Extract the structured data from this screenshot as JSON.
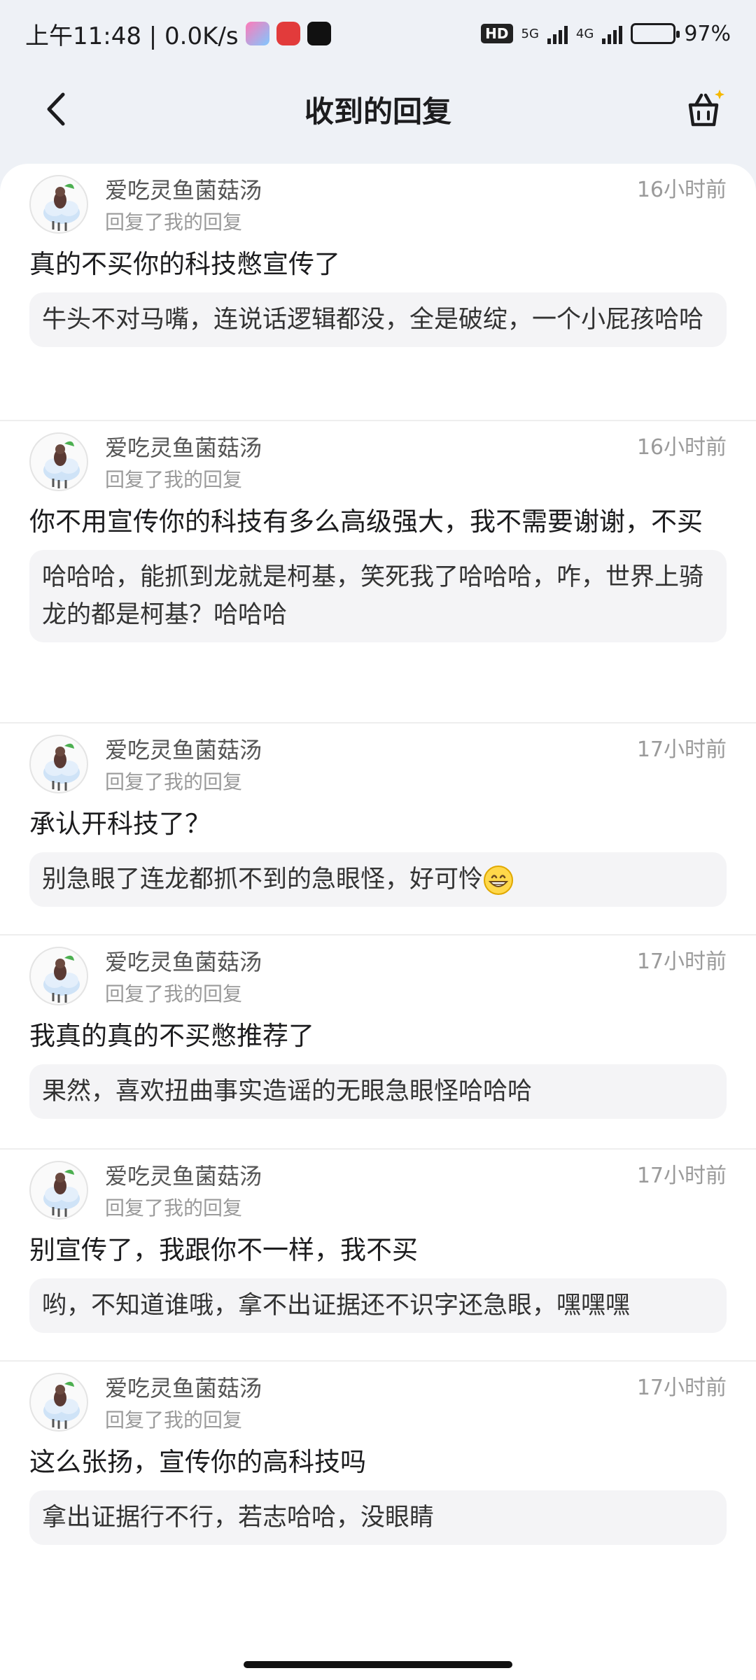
{
  "status": {
    "time_speed": "上午11:48 | 0.0K/s",
    "hd": "HD",
    "sig1": "5G",
    "sig2": "4G",
    "battery": "97%",
    "battery_level": 0.97
  },
  "nav": {
    "title": "收到的回复"
  },
  "replies": [
    {
      "user": "爱吃灵鱼菌菇汤",
      "action": "回复了我的回复",
      "time": "16小时前",
      "text": "真的不买你的科技憋宣传了",
      "quote": "牛头不对马嘴，连说话逻辑都没，全是破绽，一个小屁孩哈哈"
    },
    {
      "user": "爱吃灵鱼菌菇汤",
      "action": "回复了我的回复",
      "time": "16小时前",
      "text": "你不用宣传你的科技有多么高级强大，我不需要谢谢，不买",
      "quote": "哈哈哈，能抓到龙就是柯基，笑死我了哈哈哈，咋，世界上骑龙的都是柯基？哈哈哈"
    },
    {
      "user": "爱吃灵鱼菌菇汤",
      "action": "回复了我的回复",
      "time": "17小时前",
      "text": "承认开科技了？",
      "quote": "别急眼了连龙都抓不到的急眼怪，好可怜"
    },
    {
      "user": "爱吃灵鱼菌菇汤",
      "action": "回复了我的回复",
      "time": "17小时前",
      "text": "我真的真的不买憋推荐了",
      "quote": "果然，喜欢扭曲事实造谣的无眼急眼怪哈哈哈"
    },
    {
      "user": "爱吃灵鱼菌菇汤",
      "action": "回复了我的回复",
      "time": "17小时前",
      "text": "别宣传了，我跟你不一样，我不买",
      "quote": "哟，不知道谁哦，拿不出证据还不识字还急眼，嘿嘿嘿"
    },
    {
      "user": "爱吃灵鱼菌菇汤",
      "action": "回复了我的回复",
      "time": "17小时前",
      "text": "这么张扬，宣传你的高科技吗",
      "quote": "拿出证据行不行，若志哈哈，没眼睛"
    }
  ]
}
